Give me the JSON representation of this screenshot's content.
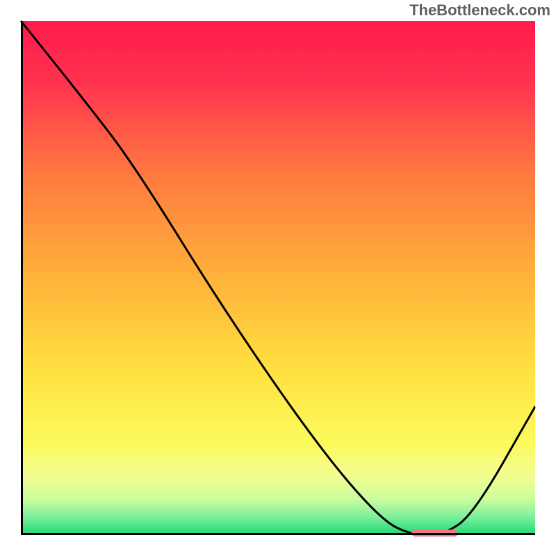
{
  "watermark": "TheBottleneck.com",
  "colors": {
    "gradient_stops": [
      {
        "offset": 0.0,
        "color": "#ff1a4a"
      },
      {
        "offset": 0.12,
        "color": "#ff3350"
      },
      {
        "offset": 0.3,
        "color": "#ff7a3f"
      },
      {
        "offset": 0.5,
        "color": "#ffb23a"
      },
      {
        "offset": 0.68,
        "color": "#ffe140"
      },
      {
        "offset": 0.82,
        "color": "#fcfa5c"
      },
      {
        "offset": 0.88,
        "color": "#f4fd8e"
      },
      {
        "offset": 0.93,
        "color": "#ccfd9e"
      },
      {
        "offset": 0.965,
        "color": "#7af09a"
      },
      {
        "offset": 1.0,
        "color": "#1fd873"
      }
    ],
    "curve_stroke": "#000000",
    "axes_stroke": "#000000",
    "marker_fill": "#ed7b86"
  },
  "chart_data": {
    "type": "line",
    "title": "",
    "xlabel": "",
    "ylabel": "",
    "xlim": [
      0,
      100
    ],
    "ylim": [
      0,
      100
    ],
    "grid": false,
    "series": [
      {
        "name": "bottleneck-curve",
        "x": [
          0,
          12,
          22,
          40,
          58,
          70,
          76,
          82,
          88,
          100
        ],
        "y": [
          100,
          85,
          72,
          43,
          17,
          3,
          0,
          0,
          4,
          25
        ]
      }
    ],
    "annotations": [
      {
        "name": "optimal-range-marker",
        "x_start": 76,
        "x_end": 85,
        "y": 0
      }
    ]
  }
}
